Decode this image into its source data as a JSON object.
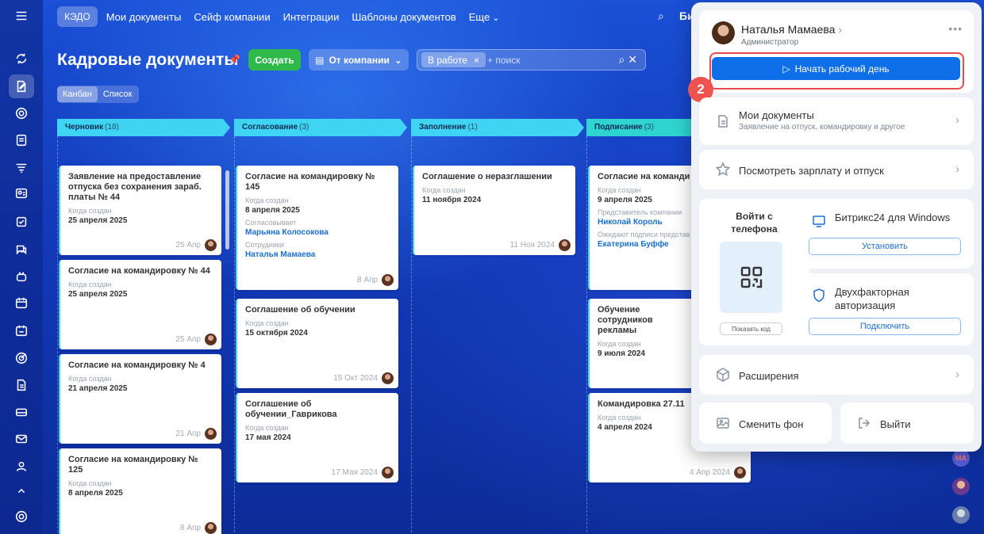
{
  "topnav": {
    "logo": "КЭДО",
    "links": [
      "Мои документы",
      "Сейф компании",
      "Интеграции",
      "Шаблоны документов"
    ],
    "more": "Еще",
    "brand": "Би"
  },
  "page": {
    "title": "Кадровые документы",
    "create_label": "Создать",
    "company_label": "От компании",
    "filter_chip": "В работе",
    "filter_placeholder": "+ поиск",
    "view_kanban": "Канбан",
    "view_list": "Список"
  },
  "columns": [
    {
      "name": "Черновик",
      "count": "(18)"
    },
    {
      "name": "Согласование",
      "count": "(3)"
    },
    {
      "name": "Заполнение",
      "count": "(1)"
    },
    {
      "name": "Подписание",
      "count": "(3)"
    }
  ],
  "cards": {
    "c1_1": {
      "title": "Заявление на предоставление отпуска без сохранения зараб. платы № 44",
      "sub1": "Когда создан",
      "val1": "25 апреля 2025",
      "date": "25 Апр"
    },
    "c1_2": {
      "title": "Согласие на командировку № 44",
      "sub1": "Когда создан",
      "val1": "25 апреля 2025",
      "date": "25 Апр"
    },
    "c1_3": {
      "title": "Согласие на командировку № 4",
      "sub1": "Когда создан",
      "val1": "21 апреля 2025",
      "date": "21 Апр"
    },
    "c1_4": {
      "title": "Согласие на командировку № 125",
      "sub1": "Когда создан",
      "val1": "8 апреля 2025",
      "date": "8 Апр"
    },
    "c2_1": {
      "title": "Согласие на командировку № 145",
      "sub1": "Когда создан",
      "val1": "8 апреля 2025",
      "sub2": "Согласовывает",
      "val2": "Марьяна Колосокова",
      "sub3": "Сотрудники",
      "val3": "Наталья Мамаева",
      "date": "8 Апр"
    },
    "c2_2": {
      "title": "Соглашение об обучении",
      "sub1": "Когда создан",
      "val1": "15 октября 2024",
      "date": "15 Окт 2024"
    },
    "c2_3": {
      "title": "Соглашение об обучении_Гаврикова",
      "sub1": "Когда создан",
      "val1": "17 мая 2024",
      "date": "17 Мая 2024"
    },
    "c3_1": {
      "title": "Соглашение о неразглашении",
      "sub1": "Когда создан",
      "val1": "11 ноября 2024",
      "date": "11 Ноя 2024"
    },
    "c4_1": {
      "title": "Согласие на команди",
      "sub1": "Когда создан",
      "val1": "9 апреля 2025",
      "sub2": "Представитель компании",
      "val2": "Николай Король",
      "sub3": "Ожидают подписи представ",
      "val3": "Екатерина Буффе"
    },
    "c4_2": {
      "title": "Обучение сотрудников рекламы",
      "sub1": "Когда создан",
      "val1": "9 июля 2024"
    },
    "c4_3": {
      "title": "Командировка 27.11",
      "sub1": "Когда создан",
      "val1": "4 апреля 2024",
      "date": "4 Апр 2024"
    }
  },
  "popup": {
    "user_name": "Наталья Мамаева",
    "user_role": "Администратор",
    "start_day": "Начать рабочий день",
    "step_number": "2",
    "my_docs_title": "Мои документы",
    "my_docs_sub": "Заявление на отпуск, командировку и другое",
    "salary_title": "Посмотреть зарплату и отпуск",
    "phone_title": "Войти с телефона",
    "show_code": "Показать код",
    "windows_title": "Битрикс24 для Windows",
    "install": "Установить",
    "twofa_title": "Двухфакторная авторизация",
    "connect": "Подключить",
    "extensions": "Расширения",
    "change_bg": "Сменить фон",
    "logout": "Выйти"
  },
  "side_avatar_initials": "МА",
  "colors": {
    "accent": "#0f6fe8",
    "create": "#2fb94b",
    "column_head": "#3fd4f3",
    "highlight": "#e94b4b"
  }
}
